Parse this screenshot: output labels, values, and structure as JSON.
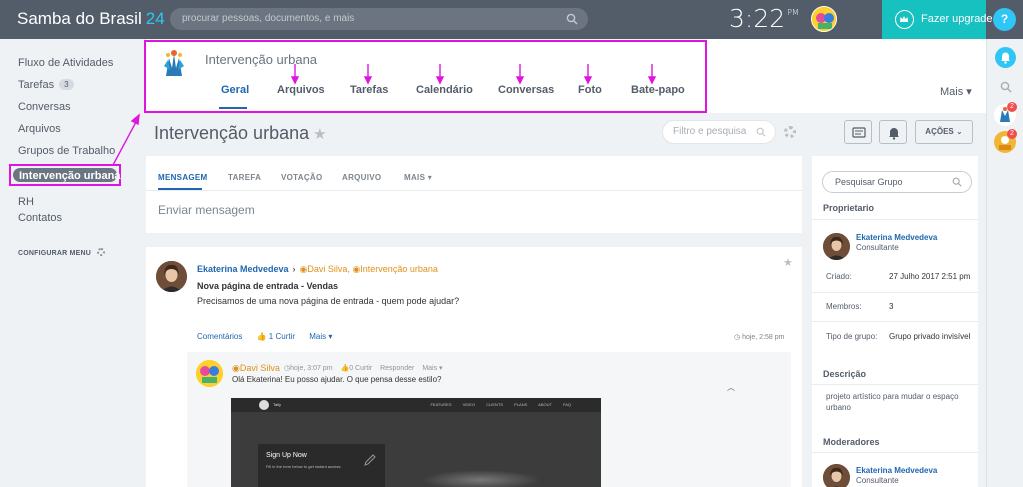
{
  "app": {
    "brand": "Samba do Brasil",
    "brand_number": "24",
    "search_placeholder": "procurar pessoas, documentos, e mais",
    "clock": "3:22",
    "clock_ampm": "PM",
    "upgrade_label": "Fazer upgrade",
    "help_label": "?"
  },
  "rail": {
    "badge_1": "2",
    "badge_2": "2"
  },
  "menu": {
    "items": [
      {
        "label": "Fluxo de Atividades"
      },
      {
        "label": "Tarefas",
        "count": "3"
      },
      {
        "label": "Conversas"
      },
      {
        "label": "Arquivos"
      },
      {
        "label": "Grupos de Trabalho"
      },
      {
        "label": "Intervenção urbana",
        "active": true
      },
      {
        "label": "RH"
      },
      {
        "label": "Contatos"
      }
    ],
    "configure": "CONFIGURAR MENU"
  },
  "group_header": {
    "title": "Intervenção urbana",
    "tabs": [
      "Geral",
      "Arquivos",
      "Tarefas",
      "Calendário",
      "Conversas",
      "Foto",
      "Bate-papo"
    ],
    "more": "Mais"
  },
  "page": {
    "title": "Intervenção urbana",
    "filter_placeholder": "Filtro e pesquisa",
    "actions_label": "AÇÕES"
  },
  "composer": {
    "tabs": [
      "MENSAGEM",
      "TAREFA",
      "VOTAÇÃO",
      "ARQUIVO",
      "MAIS"
    ],
    "placeholder": "Enviar mensagem"
  },
  "post": {
    "author": "Ekaterina Medvedeva",
    "recipients": [
      "Davi Silva",
      "Intervenção urbana"
    ],
    "title": "Nova página de entrada - Vendas",
    "body": "Precisamos de uma nova página de entrada - quem pode ajudar?",
    "comments_link": "Comentários",
    "like_label": "1 Curtir",
    "more_label": "Mais",
    "time": "hoje, 2:58 pm",
    "comment": {
      "author": "Davi Silva",
      "time": "hoje, 3:07 pm",
      "likes": "0 Curtir",
      "reply": "Responder",
      "more": "Mais",
      "text": "Olá Ekaterina! Eu posso ajudar. O que pensa desse estilo?"
    },
    "embed": {
      "brand": "Tally",
      "nav": "FEATURES VIDEO CLIENTS PLANS ABOUT FAQ",
      "panel_title": "Sign Up Now",
      "panel_sub": "Fill in the form below to get instant access:"
    }
  },
  "sidebar": {
    "search_placeholder": "Pesquisar Grupo",
    "owner_heading": "Proprietario",
    "owner": {
      "name": "Ekaterina Medvedeva",
      "role": "Consultante"
    },
    "fields": [
      {
        "key": "Criado:",
        "value": "27 Julho 2017 2:51 pm"
      },
      {
        "key": "Membros:",
        "value": "3"
      },
      {
        "key": "Tipo de grupo:",
        "value": "Grupo privado invisível"
      }
    ],
    "description_heading": "Descrição",
    "description": "projeto artístico para mudar o espaço urbano",
    "moderators_heading": "Moderadores",
    "moderator": {
      "name": "Ekaterina Medvedeva",
      "role": "Consultante"
    }
  },
  "colors": {
    "annotation": "#e014e0",
    "link_blue": "#2067b0",
    "topbar": "#535c69",
    "upgrade": "#16c1c0",
    "accent_blue": "#2fc6f6"
  },
  "icons": [
    "search-icon",
    "crown-icon",
    "bell-icon",
    "star-icon",
    "gear-icon",
    "chat-icon",
    "chevron-down-icon",
    "like-icon",
    "clock-icon",
    "pencil-icon"
  ]
}
